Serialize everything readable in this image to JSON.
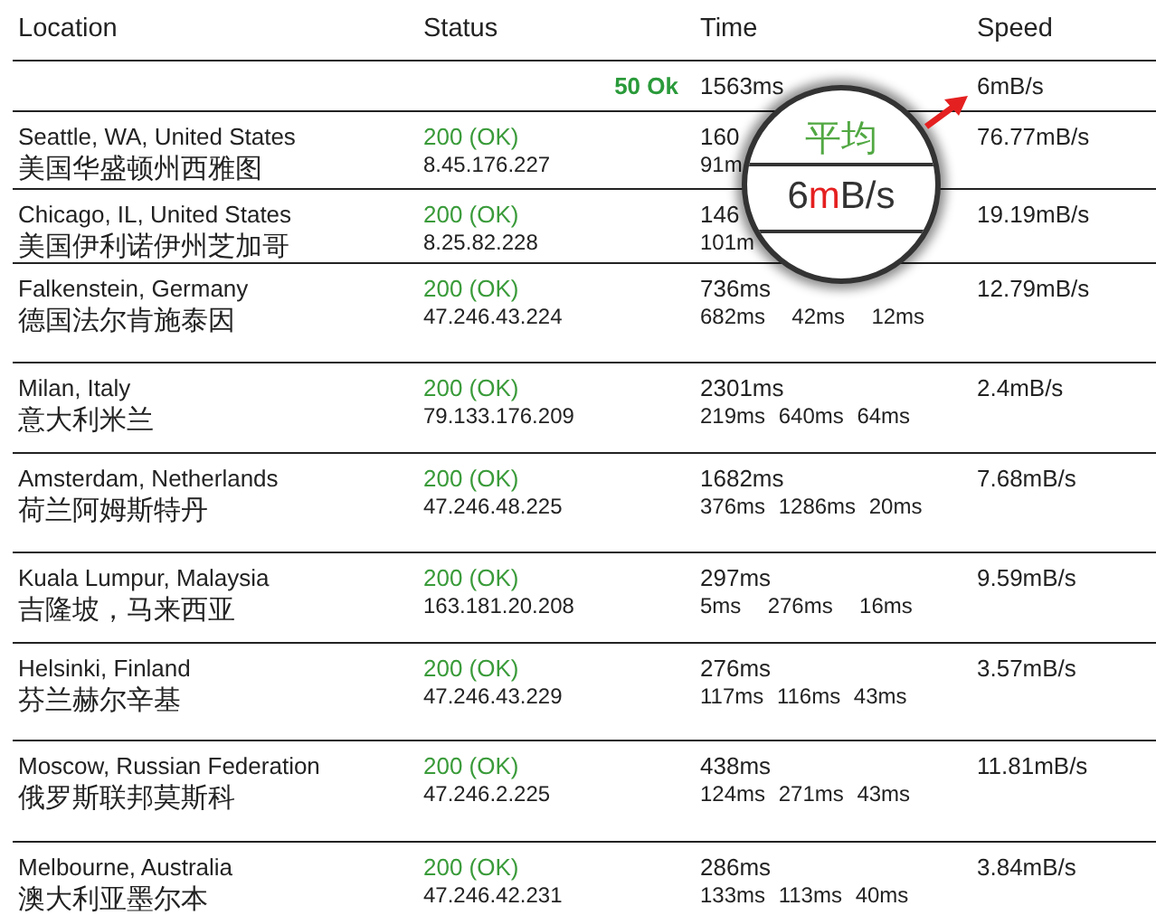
{
  "columns": [
    "Location",
    "Status",
    "Time",
    "Speed"
  ],
  "summary": {
    "status": "50 Ok",
    "time": "1563ms",
    "speed": "6mB/s"
  },
  "rows": [
    {
      "location": "Seattle, WA, United States",
      "location_zh": "美国华盛顿州西雅图",
      "status": "200 (OK)",
      "ip": "8.45.176.227",
      "time": "160",
      "time_detail": "91m",
      "speed": "76.77mB/s"
    },
    {
      "location": "Chicago, IL, United States",
      "location_zh": "美国伊利诺伊州芝加哥",
      "status": "200 (OK)",
      "ip": "8.25.82.228",
      "time": "146",
      "time_detail": "101m",
      "speed": "19.19mB/s"
    },
    {
      "location": "Falkenstein, Germany",
      "location_zh": "德国法尔肯施泰因",
      "status": "200 (OK)",
      "ip": "47.246.43.224",
      "time": "736ms",
      "time_detail": "682ms  42ms  12ms",
      "speed": "12.79mB/s"
    },
    {
      "location": "Milan, Italy",
      "location_zh": "意大利米兰",
      "status": "200 (OK)",
      "ip": "79.133.176.209",
      "time": "2301ms",
      "time_detail": "219ms 640ms 64ms",
      "speed": "2.4mB/s"
    },
    {
      "location": "Amsterdam, Netherlands",
      "location_zh": "荷兰阿姆斯特丹",
      "status": "200 (OK)",
      "ip": "47.246.48.225",
      "time": "1682ms",
      "time_detail": "376ms 1286ms 20ms",
      "speed": "7.68mB/s"
    },
    {
      "location": "Kuala Lumpur, Malaysia",
      "location_zh": "吉隆坡，马来西亚",
      "status": "200 (OK)",
      "ip": "163.181.20.208",
      "time": "297ms",
      "time_detail": "5ms  276ms  16ms",
      "speed": "9.59mB/s"
    },
    {
      "location": "Helsinki, Finland",
      "location_zh": "芬兰赫尔辛基",
      "status": "200 (OK)",
      "ip": "47.246.43.229",
      "time": "276ms",
      "time_detail": "117ms 116ms 43ms",
      "speed": "3.57mB/s"
    },
    {
      "location": "Moscow, Russian Federation",
      "location_zh": "俄罗斯联邦莫斯科",
      "status": "200 (OK)",
      "ip": "47.246.2.225",
      "time": "438ms",
      "time_detail": "124ms 271ms 43ms",
      "speed": "11.81mB/s"
    },
    {
      "location": "Melbourne, Australia",
      "location_zh": "澳大利亚墨尔本",
      "status": "200 (OK)",
      "ip": "47.246.42.231",
      "time": "286ms",
      "time_detail": "133ms 113ms 40ms",
      "speed": "3.84mB/s"
    }
  ],
  "magnifier": {
    "label": "平均",
    "value": [
      {
        "text": "6",
        "highlight": false
      },
      {
        "text": "m",
        "highlight": true
      },
      {
        "text": "B/s",
        "highlight": false
      }
    ]
  }
}
